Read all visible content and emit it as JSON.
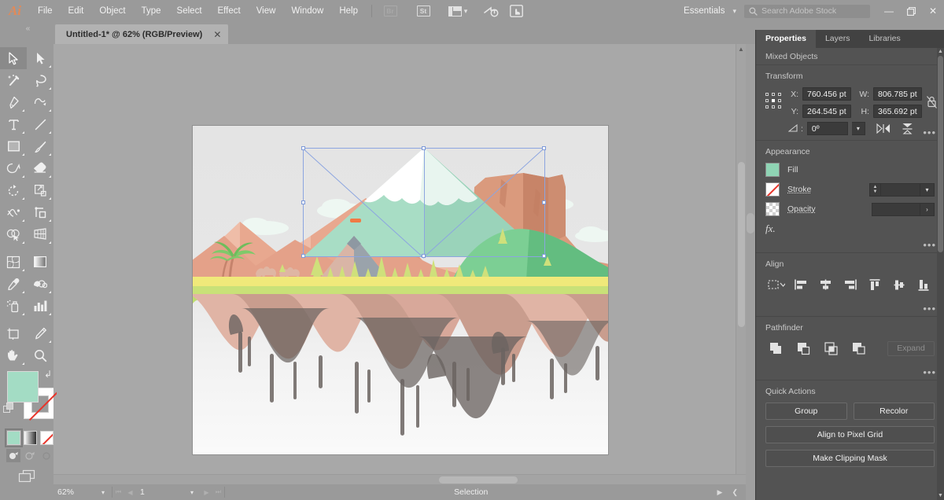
{
  "app": {
    "logo": "Ai",
    "menus": [
      "File",
      "Edit",
      "Object",
      "Type",
      "Select",
      "Effect",
      "View",
      "Window",
      "Help"
    ],
    "toolbar_icons": [
      {
        "name": "bridge-icon",
        "label": "Br"
      },
      {
        "name": "stock-icon",
        "label": "St"
      },
      {
        "name": "arrange-documents-icon",
        "label": ""
      }
    ],
    "workspace": "Essentials",
    "window_controls": {
      "minimize": "—",
      "restore": "❐",
      "close": "✕"
    }
  },
  "search": {
    "placeholder": "Search Adobe Stock"
  },
  "document": {
    "tab_title": "Untitled-1* @ 62% (RGB/Preview)",
    "close_label": "✕"
  },
  "tools": [
    {
      "name": "selection-tool",
      "label": "Selection Tool",
      "active": true
    },
    {
      "name": "direct-selection-tool",
      "label": "Direct Selection Tool"
    },
    {
      "name": "magic-wand-tool",
      "label": "Magic Wand Tool"
    },
    {
      "name": "lasso-tool",
      "label": "Lasso Tool"
    },
    {
      "name": "pen-tool",
      "label": "Pen Tool"
    },
    {
      "name": "curvature-tool",
      "label": "Curvature Tool"
    },
    {
      "name": "type-tool",
      "label": "Type Tool"
    },
    {
      "name": "line-segment-tool",
      "label": "Line Segment Tool"
    },
    {
      "name": "rectangle-tool",
      "label": "Rectangle Tool"
    },
    {
      "name": "paintbrush-tool",
      "label": "Paintbrush Tool"
    },
    {
      "name": "shaper-tool",
      "label": "Shaper Tool"
    },
    {
      "name": "eraser-tool",
      "label": "Eraser Tool"
    },
    {
      "name": "rotate-tool",
      "label": "Rotate Tool"
    },
    {
      "name": "scale-tool",
      "label": "Scale Tool"
    },
    {
      "name": "width-tool",
      "label": "Width Tool"
    },
    {
      "name": "free-transform-tool",
      "label": "Free Transform Tool"
    },
    {
      "name": "shape-builder-tool",
      "label": "Shape Builder Tool"
    },
    {
      "name": "perspective-grid-tool",
      "label": "Perspective Grid Tool"
    },
    {
      "name": "mesh-tool",
      "label": "Mesh Tool"
    },
    {
      "name": "gradient-tool",
      "label": "Gradient Tool"
    },
    {
      "name": "eyedropper-tool",
      "label": "Eyedropper Tool"
    },
    {
      "name": "blend-tool",
      "label": "Blend Tool"
    },
    {
      "name": "symbol-sprayer-tool",
      "label": "Symbol Sprayer Tool"
    },
    {
      "name": "column-graph-tool",
      "label": "Column Graph Tool"
    },
    {
      "name": "artboard-tool",
      "label": "Artboard Tool"
    },
    {
      "name": "slice-tool",
      "label": "Slice Tool"
    },
    {
      "name": "hand-tool",
      "label": "Hand Tool"
    },
    {
      "name": "zoom-tool",
      "label": "Zoom Tool"
    }
  ],
  "swatches": {
    "fill_color": "#a3dcc4",
    "stroke_color": "#ffffff",
    "stroke_none": true,
    "modes": [
      {
        "name": "color-mode",
        "selected": true
      },
      {
        "name": "gradient-mode",
        "selected": false
      },
      {
        "name": "none-mode",
        "selected": false
      }
    ],
    "draw_modes": [
      {
        "name": "draw-normal",
        "selected": true
      },
      {
        "name": "draw-behind",
        "selected": false
      },
      {
        "name": "draw-inside",
        "selected": false
      }
    ]
  },
  "status_bar": {
    "zoom": "62%",
    "page": "1",
    "tool_status": "Selection"
  },
  "panel": {
    "tabs": [
      {
        "name": "tab-properties",
        "label": "Properties",
        "active": true
      },
      {
        "name": "tab-layers",
        "label": "Layers",
        "active": false
      },
      {
        "name": "tab-libraries",
        "label": "Libraries",
        "active": false
      }
    ],
    "selection_header": "Mixed Objects",
    "transform": {
      "title": "Transform",
      "x_label": "X:",
      "x_value": "760.456 pt",
      "y_label": "Y:",
      "y_value": "264.545 pt",
      "w_label": "W:",
      "w_value": "806.785 pt",
      "h_label": "H:",
      "h_value": "365.692 pt",
      "angle_value": "0º",
      "more_options": "•••"
    },
    "appearance": {
      "title": "Appearance",
      "fill_label": "Fill",
      "fill_color": "#8fd4b4",
      "stroke_label": "Stroke",
      "stroke_value": "",
      "opacity_label": "Opacity",
      "opacity_value": "",
      "fx_label": "fx.",
      "more_options": "•••"
    },
    "align": {
      "title": "Align",
      "buttons": [
        "align-to-selection",
        "horizontal-align-left",
        "horizontal-align-center",
        "horizontal-align-right",
        "vertical-align-top",
        "vertical-align-middle",
        "vertical-align-bottom"
      ],
      "more_options": "•••"
    },
    "pathfinder": {
      "title": "Pathfinder",
      "buttons": [
        "unite",
        "minus-front",
        "intersect",
        "exclude"
      ],
      "expand_label": "Expand",
      "more_options": "•••"
    },
    "quick_actions": {
      "title": "Quick Actions",
      "group_label": "Group",
      "recolor_label": "Recolor",
      "align_pixel_grid_label": "Align to Pixel Grid",
      "clipping_mask_label": "Make Clipping Mask"
    }
  },
  "artwork": {
    "title": "floating-island-landscape-illustration",
    "colors": {
      "sky_top": "#e4e4e4",
      "sky_bottom": "#fafafa",
      "mint_mountain": "#a8ddc5",
      "mint_mountain_dark": "#9ad3ba",
      "snow": "#ffffff",
      "snow_shadow": "#e8f5ef",
      "desert_mountain": "#e8a88f",
      "desert_mountain_light": "#efbda8",
      "desert_mountain_dark": "#d99a82",
      "mesa": "#da9a7d",
      "mesa_dark": "#c78468",
      "green_hill": "#7ccf94",
      "green_hill_dark": "#63bd80",
      "grass_top": "#f0e97a",
      "grass_green": "#bede6e",
      "island_rock_light": "#e0b4a5",
      "island_rock": "#c99d8e",
      "island_rock_dark": "#b98b7c",
      "island_shadow": "#6b6461",
      "tree_green": "#cfe07b",
      "cloud": "#eef7f2"
    }
  },
  "selection": {
    "visible": true,
    "bbox_color": "#8ca5e0",
    "handle_fill": "#ffffff"
  }
}
